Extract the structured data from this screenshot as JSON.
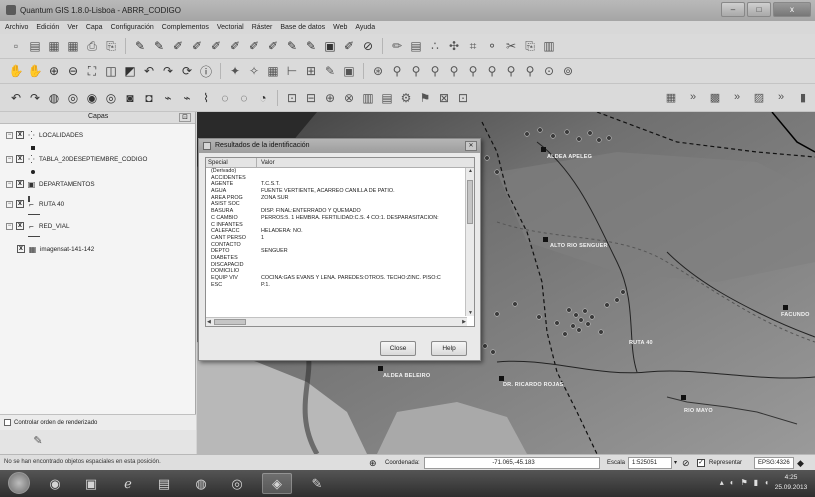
{
  "window": {
    "title": "Quantum GIS 1.8.0-Lisboa - ABRR_CODIGO",
    "min_label": "–",
    "max_label": "□",
    "close_label": "x"
  },
  "menu": [
    "Archivo",
    "Edición",
    "Ver",
    "Capa",
    "Configuración",
    "Complementos",
    "Vectorial",
    "Ráster",
    "Base de datos",
    "Web",
    "Ayuda"
  ],
  "layers_panel": {
    "title": "Capas",
    "layers": [
      {
        "name": "LOCALIDADES",
        "checked": "x",
        "icon": "point-layer-icon"
      },
      {
        "name": "TABLA_20DESEPTIEMBRE_CODIGO",
        "checked": "x",
        "icon": "point-layer-icon"
      },
      {
        "name": "DEPARTAMENTOS",
        "checked": "x",
        "icon": "polygon-layer-icon"
      },
      {
        "name": "RUTA 40",
        "checked": "x",
        "icon": "line-layer-icon"
      },
      {
        "name": "RED_VIAL",
        "checked": "x",
        "icon": "line-layer-icon"
      },
      {
        "name": "imagensat-141-142",
        "checked": "x",
        "icon": "raster-layer-icon"
      }
    ],
    "render_order_label": "Controlar orden de renderizado"
  },
  "dialog": {
    "title": "Resultados de la identificación",
    "col_feature": "Special",
    "col_value": "Valor",
    "rows": [
      {
        "attr": "(Derivado)",
        "value": ""
      },
      {
        "attr": "ACCIDENTES",
        "value": ""
      },
      {
        "attr": "AGENTE",
        "value": "T.C.S.T."
      },
      {
        "attr": "AGUA",
        "value": "FUENTE VERTIENTE, ACARREO CANILLA DE PATIO."
      },
      {
        "attr": "AREA PROG",
        "value": "ZONA SUR"
      },
      {
        "attr": "ASIST SOC",
        "value": ""
      },
      {
        "attr": "BASURA",
        "value": "DISP. FINAL:ENTERRADO Y QUEMADO"
      },
      {
        "attr": "C CAMBIO",
        "value": "PERROS:5. 1 HEMBRA. FERTILIDAD:C.S. 4 CO:1. DESPARASITACION:"
      },
      {
        "attr": "C INFANTES",
        "value": ""
      },
      {
        "attr": "CALEFACC",
        "value": "HELADERA: NO."
      },
      {
        "attr": "CANT PERSO",
        "value": "1"
      },
      {
        "attr": "CONTACTO",
        "value": ""
      },
      {
        "attr": "DEPTO",
        "value": "SENGUER"
      },
      {
        "attr": "DIABETES",
        "value": ""
      },
      {
        "attr": "DISCAPACID",
        "value": ""
      },
      {
        "attr": "DOMICILIO",
        "value": ""
      },
      {
        "attr": "EQUIP VIV",
        "value": "COCINA:GAS EVANS Y LEÑA. PAREDES:OTROS. TECHO:ZINC. PISO:C"
      },
      {
        "attr": "ESC",
        "value": "P.1."
      }
    ],
    "close_button": "Close",
    "help_button": "Help"
  },
  "map_labels": [
    {
      "text": "ALDEA APELEG"
    },
    {
      "text": "ALTO RIO SENGUER"
    },
    {
      "text": "FACUNDO"
    },
    {
      "text": "RUTA 40"
    },
    {
      "text": "ALDEA BELEIRO"
    },
    {
      "text": "DR. RICARDO ROJAS"
    },
    {
      "text": "RIO MAYO"
    }
  ],
  "statusbar": {
    "message": "No se han encontrado objetos espaciales en esta posición.",
    "coord_label": "Coordenada:",
    "coord_value": "-71.065,-45.183",
    "scale_label": "Escala",
    "scale_value": "1:525051",
    "render_label": "Representar",
    "crs": "EPSG:4326"
  },
  "taskbar": {
    "apps": [
      "media-player-icon",
      "explorer-icon",
      "ie-icon",
      "folder-icon",
      "media-icon",
      "chrome-icon",
      "qgis-icon",
      "paint-icon"
    ],
    "time": "4:25",
    "date": "25.09.2013"
  }
}
